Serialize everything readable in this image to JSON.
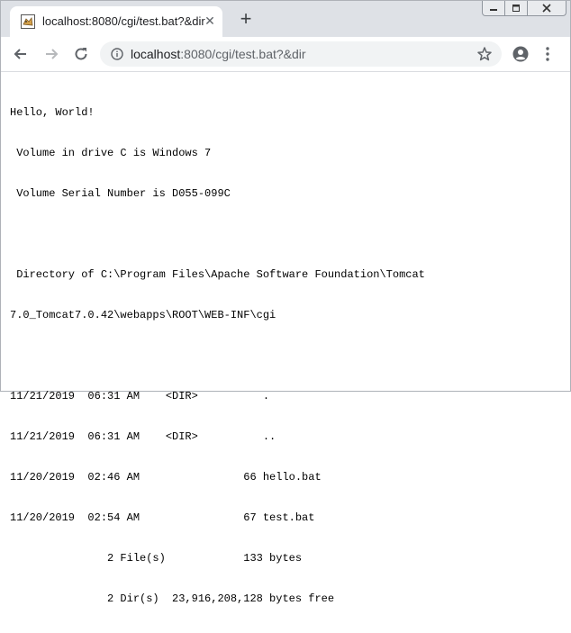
{
  "tab": {
    "title": "localhost:8080/cgi/test.bat?&dir",
    "close_glyph": "✕",
    "new_tab_glyph": "+",
    "favicon": "tomcat-favicon"
  },
  "window_controls": [
    "minimize-icon",
    "restore-icon",
    "close-icon"
  ],
  "toolbar": {
    "back_icon": "arrow-left-icon",
    "forward_icon": "arrow-right-icon",
    "reload_icon": "reload-icon",
    "url_host": "localhost",
    "url_rest": ":8080/cgi/test.bat?&dir",
    "bookmark_icon": "star-icon",
    "profile_icon": "account-circle-icon",
    "menu_icon": "kebab-menu-icon"
  },
  "output": {
    "lines": [
      "Hello, World!",
      " Volume in drive C is Windows 7",
      " Volume Serial Number is D055-099C",
      "",
      " Directory of C:\\Program Files\\Apache Software Foundation\\Tomcat",
      "7.0_Tomcat7.0.42\\webapps\\ROOT\\WEB-INF\\cgi",
      "",
      "11/21/2019  06:31 AM    <DIR>          .",
      "11/21/2019  06:31 AM    <DIR>          ..",
      "11/20/2019  02:46 AM                66 hello.bat",
      "11/20/2019  02:54 AM                67 test.bat",
      "               2 File(s)            133 bytes",
      "               2 Dir(s)  23,916,208,128 bytes free"
    ]
  },
  "colors": {
    "tabstrip": "#dee1e6",
    "omnibox": "#f1f3f4",
    "icon": "#5f6368"
  }
}
